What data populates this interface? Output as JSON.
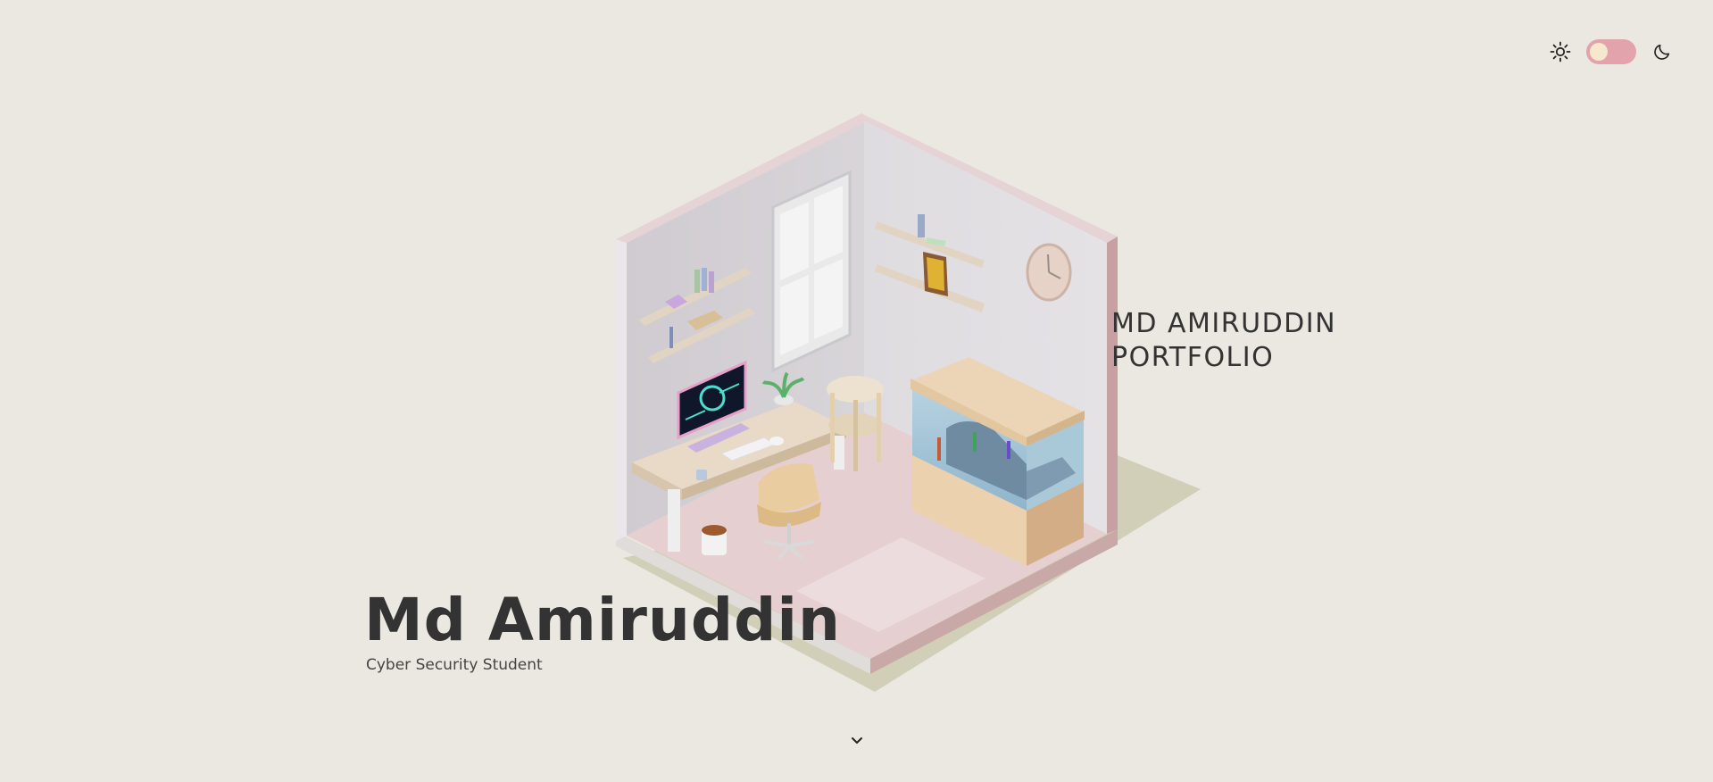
{
  "header": {
    "theme_toggle": {
      "state": "light",
      "track_color": "#e3a3ad",
      "knob_color": "#f6e8cc"
    },
    "light_icon": "sun-icon",
    "dark_icon": "moon-icon"
  },
  "room": {
    "title_line1": "MD AMIRUDDIN",
    "title_line2": "PORTFOLIO"
  },
  "hero": {
    "name": "Md Amiruddin",
    "subtitle": "Cyber Security Student"
  },
  "scroll": {
    "icon": "chevron-down-icon"
  },
  "colors": {
    "background": "#ebe8e1",
    "text": "#333333",
    "accent": "#e3a3ad"
  }
}
